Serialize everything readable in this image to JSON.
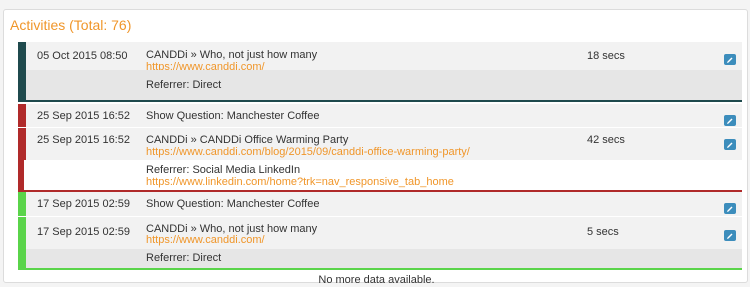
{
  "panel": {
    "title": "Activities (Total: 76)",
    "footer": "No more data available."
  },
  "colors": {
    "accent": "#f0962a",
    "group_teal": "#1f4a4d",
    "group_red": "#b02a2a",
    "group_green": "#5ad44a",
    "edit_button": "#3c8dbc"
  },
  "groups": [
    {
      "activities": [
        {
          "date": "05 Oct 2015 08:50",
          "title": "CANDDi » Who, not just how many",
          "url": "https://www.canddi.com/",
          "duration": "18 secs"
        }
      ],
      "referrer": {
        "label": "Referrer: Direct",
        "url": ""
      }
    },
    {
      "activities": [
        {
          "date": "25 Sep 2015 16:52",
          "title": "Show Question: Manchester Coffee",
          "url": "",
          "duration": ""
        },
        {
          "date": "25 Sep 2015 16:52",
          "title": "CANDDi » CANDDi Office Warming Party",
          "url": "https://www.canddi.com/blog/2015/09/canddi-office-warming-party/",
          "duration": "42 secs"
        }
      ],
      "referrer": {
        "label": "Referrer: Social Media LinkedIn",
        "url": "https://www.linkedin.com/home?trk=nav_responsive_tab_home"
      }
    },
    {
      "activities": [
        {
          "date": "17 Sep 2015 02:59",
          "title": "Show Question: Manchester Coffee",
          "url": "",
          "duration": ""
        },
        {
          "date": "17 Sep 2015 02:59",
          "title": "CANDDi » Who, not just how many",
          "url": "https://www.canddi.com/",
          "duration": "5 secs"
        }
      ],
      "referrer": {
        "label": "Referrer: Direct",
        "url": ""
      }
    }
  ]
}
